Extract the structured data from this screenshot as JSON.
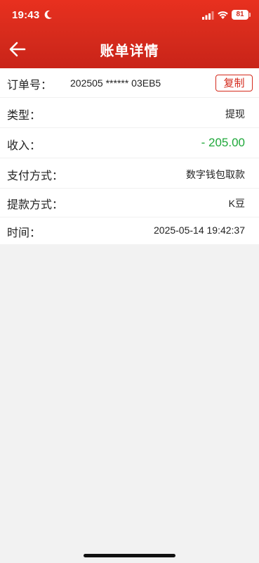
{
  "status_bar": {
    "time": "19:43",
    "battery_level": "81"
  },
  "header": {
    "title": "账单详情",
    "back_icon": "arrow-left-icon"
  },
  "details": {
    "order": {
      "label": "订单号：",
      "value": "202505 ****** 03EB5",
      "copy_label": "复制"
    },
    "type": {
      "label": "类型：",
      "value": "提现"
    },
    "income": {
      "label": "收入：",
      "value": "- 205.00",
      "color": "#1fa83a"
    },
    "payment_method": {
      "label": "支付方式：",
      "value": "数字钱包取款"
    },
    "withdraw_method": {
      "label": "提款方式：",
      "value": "K豆"
    },
    "time": {
      "label": "时间：",
      "value": "2025-05-14 19:42:37"
    }
  },
  "colors": {
    "header_red": "#d42a1c",
    "accent_red": "#d42a1c",
    "amount_green": "#1fa83a",
    "page_background": "#f2f2f2"
  }
}
